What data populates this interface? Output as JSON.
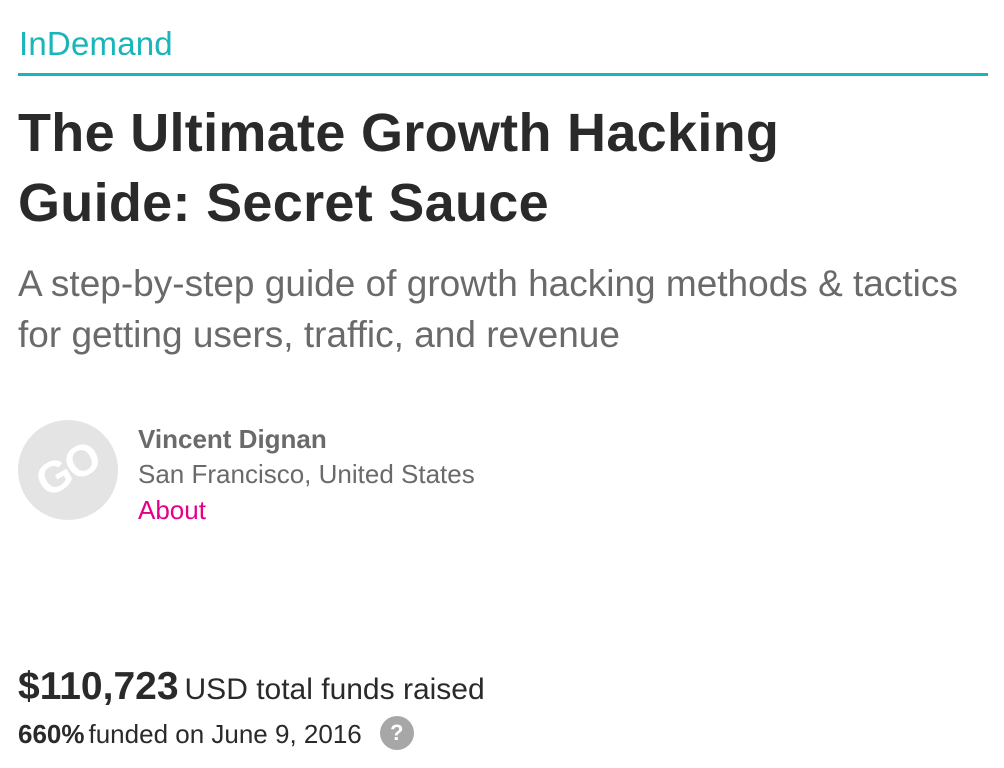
{
  "header": {
    "brand": "InDemand",
    "accent_color": "#18b5ba"
  },
  "campaign": {
    "title": "The Ultimate Growth Hacking Guide: Secret Sauce",
    "tagline": "A step-by-step guide of growth hacking methods & tactics for getting users, traffic, and revenue"
  },
  "owner": {
    "avatar_text": "GO",
    "name": "Vincent Dignan",
    "location": "San Francisco, United States",
    "about_label": "About",
    "about_color": "#e5008a"
  },
  "funding": {
    "amount": "$110,723",
    "amount_label": "USD total funds raised",
    "percent": "660%",
    "funded_text": "funded on June 9, 2016",
    "help_icon": "question-circle-icon",
    "help_glyph": "?"
  }
}
